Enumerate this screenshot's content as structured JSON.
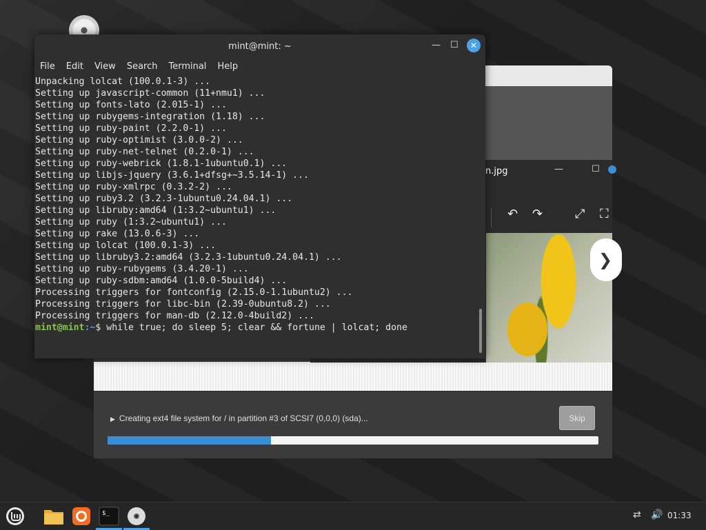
{
  "terminal": {
    "title": "mint@mint: ~",
    "menu": [
      "File",
      "Edit",
      "View",
      "Search",
      "Terminal",
      "Help"
    ],
    "lines": [
      "Unpacking lolcat (100.0.1-3) ...",
      "Setting up javascript-common (11+nmu1) ...",
      "Setting up fonts-lato (2.015-1) ...",
      "Setting up rubygems-integration (1.18) ...",
      "Setting up ruby-paint (2.2.0-1) ...",
      "Setting up ruby-optimist (3.0.0-2) ...",
      "Setting up ruby-net-telnet (0.2.0-1) ...",
      "Setting up ruby-webrick (1.8.1-1ubuntu0.1) ...",
      "Setting up libjs-jquery (3.6.1+dfsg+~3.5.14-1) ...",
      "Setting up ruby-xmlrpc (0.3.2-2) ...",
      "Setting up ruby3.2 (3.2.3-1ubuntu0.24.04.1) ...",
      "Setting up libruby:amd64 (1:3.2~ubuntu1) ...",
      "Setting up ruby (1:3.2~ubuntu1) ...",
      "Setting up rake (13.0.6-3) ...",
      "Setting up lolcat (100.0.1-3) ...",
      "Setting up libruby3.2:amd64 (3.2.3-1ubuntu0.24.04.1) ...",
      "Setting up ruby-rubygems (3.4.20-1) ...",
      "Setting up ruby-sdbm:amd64 (1.0.0-5build4) ...",
      "Processing triggers for fontconfig (2.15.0-1.1ubuntu2) ...",
      "Processing triggers for libc-bin (2.39-0ubuntu8.2) ...",
      "Processing triggers for man-db (2.12.0-4build2) ..."
    ],
    "prompt_user": "mint@mint",
    "prompt_path": ":~",
    "prompt_symbol": "$",
    "command": " while true; do sleep 5; clear && fortune | lolcat; done"
  },
  "viewer": {
    "title": "n.jpg"
  },
  "installer": {
    "status": "Creating ext4 file system for / in partition #3 of SCSI7 (0,0,0) (sda)...",
    "skip_label": "Skip",
    "progress": 0.333
  },
  "taskbar": {
    "clock": "01:33",
    "items": [
      "mint-menu-icon",
      "files-icon",
      "firefox-icon",
      "terminal-icon",
      "disc-icon"
    ]
  },
  "colors": {
    "accent": "#3a8fd4",
    "prompt_user": "#88c34a",
    "prompt_path": "#5aa0e6"
  }
}
